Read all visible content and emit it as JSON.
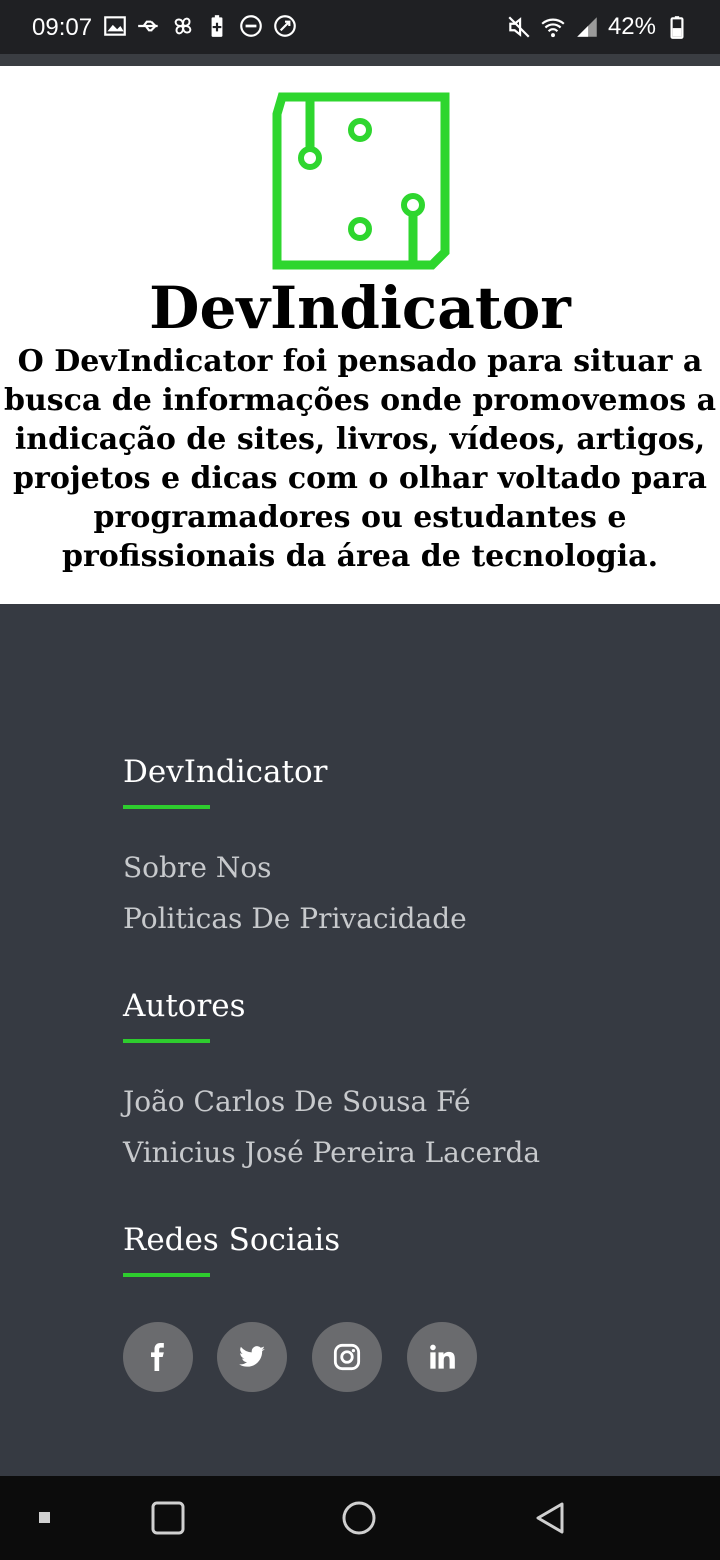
{
  "status_bar": {
    "time": "09:07",
    "battery": "42%"
  },
  "hero": {
    "title": "DevIndicator",
    "description_lines": [
      "O DevIndicator foi pensado para situar a",
      "busca de informações onde promovemos a",
      "indicação de sites, livros, vídeos, artigos,",
      "projetos e dicas com o olhar voltado para",
      "programadores ou estudantes e",
      "profissionais da área de tecnologia."
    ]
  },
  "footer": {
    "sections": [
      {
        "title": "DevIndicator",
        "links": [
          "Sobre Nos",
          "Politicas De Privacidade"
        ]
      },
      {
        "title": "Autores",
        "links": [
          "João Carlos De Sousa Fé",
          "Vinicius José Pereira Lacerda"
        ]
      },
      {
        "title": "Redes Sociais"
      }
    ],
    "social": [
      "facebook-icon",
      "twitter-icon",
      "instagram-icon",
      "linkedin-icon"
    ]
  },
  "colors": {
    "accent": "#2ecc2e",
    "footer_bg": "#363a42",
    "social_bg": "#6a6b6e"
  }
}
